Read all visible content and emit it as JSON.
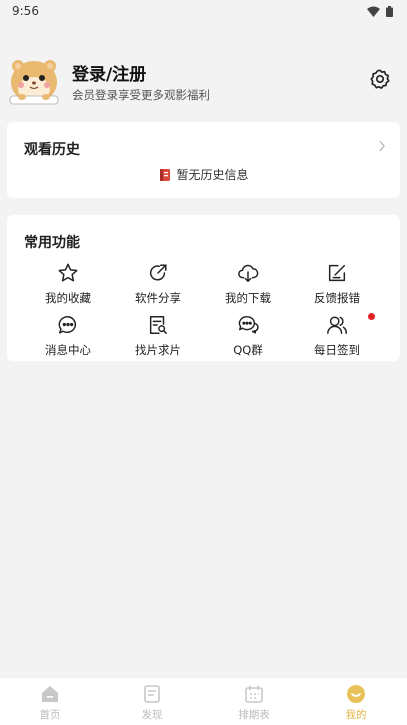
{
  "status_bar": {
    "time": "9:56"
  },
  "profile": {
    "title": "登录/注册",
    "subtitle": "会员登录享受更多观影福利"
  },
  "history": {
    "title": "观看历史",
    "empty_text": "暂无历史信息"
  },
  "functions": {
    "title": "常用功能",
    "items": [
      {
        "label": "我的收藏",
        "icon": "star-icon"
      },
      {
        "label": "软件分享",
        "icon": "share-icon"
      },
      {
        "label": "我的下载",
        "icon": "cloud-download-icon"
      },
      {
        "label": "反馈报错",
        "icon": "feedback-edit-icon"
      },
      {
        "label": "消息中心",
        "icon": "message-icon"
      },
      {
        "label": "找片求片",
        "icon": "search-document-icon"
      },
      {
        "label": "QQ群",
        "icon": "chat-bubbles-icon"
      },
      {
        "label": "每日签到",
        "icon": "users-icon",
        "has_badge": true
      }
    ]
  },
  "tabbar": {
    "tabs": [
      {
        "label": "首页",
        "icon": "home-icon",
        "active": false
      },
      {
        "label": "发现",
        "icon": "discover-icon",
        "active": false
      },
      {
        "label": "排期表",
        "icon": "calendar-icon",
        "active": false
      },
      {
        "label": "我的",
        "icon": "smile-icon",
        "active": true
      }
    ]
  },
  "colors": {
    "accent": "#e2b647",
    "badge": "#e02020",
    "inactive_tab": "#bbbbbb"
  }
}
